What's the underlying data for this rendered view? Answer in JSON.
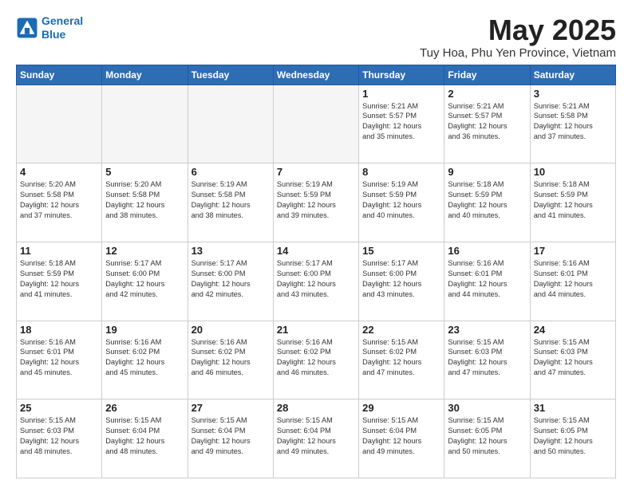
{
  "logo": {
    "line1": "General",
    "line2": "Blue"
  },
  "title": "May 2025",
  "location": "Tuy Hoa, Phu Yen Province, Vietnam",
  "weekdays": [
    "Sunday",
    "Monday",
    "Tuesday",
    "Wednesday",
    "Thursday",
    "Friday",
    "Saturday"
  ],
  "weeks": [
    [
      {
        "day": "",
        "info": ""
      },
      {
        "day": "",
        "info": ""
      },
      {
        "day": "",
        "info": ""
      },
      {
        "day": "",
        "info": ""
      },
      {
        "day": "1",
        "info": "Sunrise: 5:21 AM\nSunset: 5:57 PM\nDaylight: 12 hours\nand 35 minutes."
      },
      {
        "day": "2",
        "info": "Sunrise: 5:21 AM\nSunset: 5:57 PM\nDaylight: 12 hours\nand 36 minutes."
      },
      {
        "day": "3",
        "info": "Sunrise: 5:21 AM\nSunset: 5:58 PM\nDaylight: 12 hours\nand 37 minutes."
      }
    ],
    [
      {
        "day": "4",
        "info": "Sunrise: 5:20 AM\nSunset: 5:58 PM\nDaylight: 12 hours\nand 37 minutes."
      },
      {
        "day": "5",
        "info": "Sunrise: 5:20 AM\nSunset: 5:58 PM\nDaylight: 12 hours\nand 38 minutes."
      },
      {
        "day": "6",
        "info": "Sunrise: 5:19 AM\nSunset: 5:58 PM\nDaylight: 12 hours\nand 38 minutes."
      },
      {
        "day": "7",
        "info": "Sunrise: 5:19 AM\nSunset: 5:59 PM\nDaylight: 12 hours\nand 39 minutes."
      },
      {
        "day": "8",
        "info": "Sunrise: 5:19 AM\nSunset: 5:59 PM\nDaylight: 12 hours\nand 40 minutes."
      },
      {
        "day": "9",
        "info": "Sunrise: 5:18 AM\nSunset: 5:59 PM\nDaylight: 12 hours\nand 40 minutes."
      },
      {
        "day": "10",
        "info": "Sunrise: 5:18 AM\nSunset: 5:59 PM\nDaylight: 12 hours\nand 41 minutes."
      }
    ],
    [
      {
        "day": "11",
        "info": "Sunrise: 5:18 AM\nSunset: 5:59 PM\nDaylight: 12 hours\nand 41 minutes."
      },
      {
        "day": "12",
        "info": "Sunrise: 5:17 AM\nSunset: 6:00 PM\nDaylight: 12 hours\nand 42 minutes."
      },
      {
        "day": "13",
        "info": "Sunrise: 5:17 AM\nSunset: 6:00 PM\nDaylight: 12 hours\nand 42 minutes."
      },
      {
        "day": "14",
        "info": "Sunrise: 5:17 AM\nSunset: 6:00 PM\nDaylight: 12 hours\nand 43 minutes."
      },
      {
        "day": "15",
        "info": "Sunrise: 5:17 AM\nSunset: 6:00 PM\nDaylight: 12 hours\nand 43 minutes."
      },
      {
        "day": "16",
        "info": "Sunrise: 5:16 AM\nSunset: 6:01 PM\nDaylight: 12 hours\nand 44 minutes."
      },
      {
        "day": "17",
        "info": "Sunrise: 5:16 AM\nSunset: 6:01 PM\nDaylight: 12 hours\nand 44 minutes."
      }
    ],
    [
      {
        "day": "18",
        "info": "Sunrise: 5:16 AM\nSunset: 6:01 PM\nDaylight: 12 hours\nand 45 minutes."
      },
      {
        "day": "19",
        "info": "Sunrise: 5:16 AM\nSunset: 6:02 PM\nDaylight: 12 hours\nand 45 minutes."
      },
      {
        "day": "20",
        "info": "Sunrise: 5:16 AM\nSunset: 6:02 PM\nDaylight: 12 hours\nand 46 minutes."
      },
      {
        "day": "21",
        "info": "Sunrise: 5:16 AM\nSunset: 6:02 PM\nDaylight: 12 hours\nand 46 minutes."
      },
      {
        "day": "22",
        "info": "Sunrise: 5:15 AM\nSunset: 6:02 PM\nDaylight: 12 hours\nand 47 minutes."
      },
      {
        "day": "23",
        "info": "Sunrise: 5:15 AM\nSunset: 6:03 PM\nDaylight: 12 hours\nand 47 minutes."
      },
      {
        "day": "24",
        "info": "Sunrise: 5:15 AM\nSunset: 6:03 PM\nDaylight: 12 hours\nand 47 minutes."
      }
    ],
    [
      {
        "day": "25",
        "info": "Sunrise: 5:15 AM\nSunset: 6:03 PM\nDaylight: 12 hours\nand 48 minutes."
      },
      {
        "day": "26",
        "info": "Sunrise: 5:15 AM\nSunset: 6:04 PM\nDaylight: 12 hours\nand 48 minutes."
      },
      {
        "day": "27",
        "info": "Sunrise: 5:15 AM\nSunset: 6:04 PM\nDaylight: 12 hours\nand 49 minutes."
      },
      {
        "day": "28",
        "info": "Sunrise: 5:15 AM\nSunset: 6:04 PM\nDaylight: 12 hours\nand 49 minutes."
      },
      {
        "day": "29",
        "info": "Sunrise: 5:15 AM\nSunset: 6:04 PM\nDaylight: 12 hours\nand 49 minutes."
      },
      {
        "day": "30",
        "info": "Sunrise: 5:15 AM\nSunset: 6:05 PM\nDaylight: 12 hours\nand 50 minutes."
      },
      {
        "day": "31",
        "info": "Sunrise: 5:15 AM\nSunset: 6:05 PM\nDaylight: 12 hours\nand 50 minutes."
      }
    ]
  ]
}
